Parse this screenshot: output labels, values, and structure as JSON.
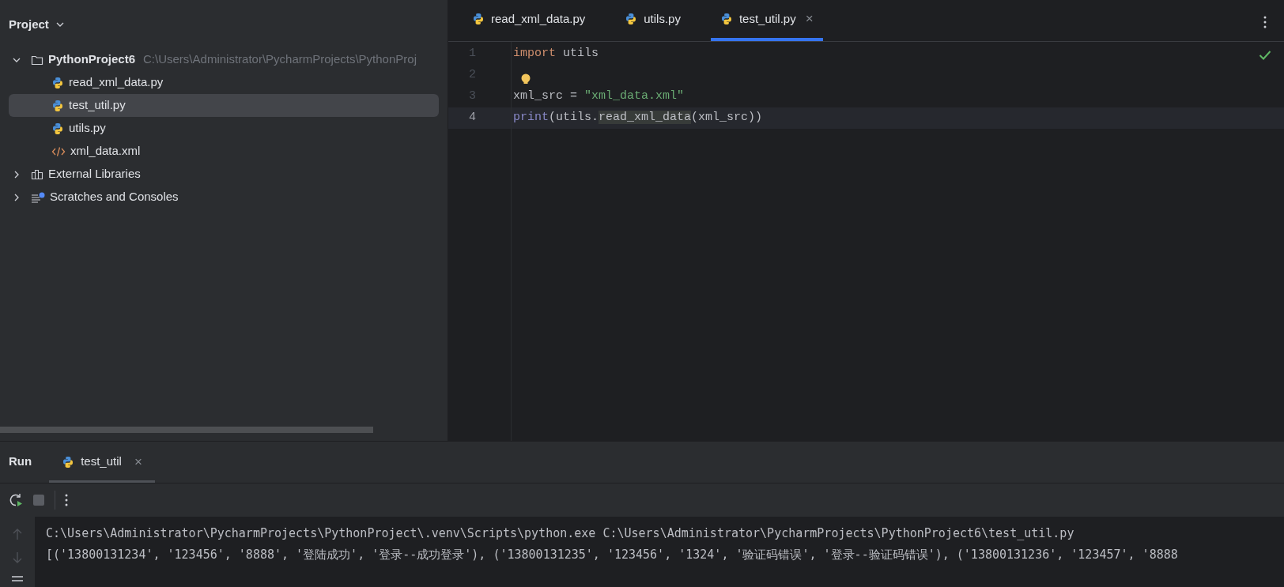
{
  "sidebar": {
    "title": "Project",
    "tree": [
      {
        "label": "PythonProject6",
        "path": "C:\\Users\\Administrator\\PycharmProjects\\PythonProj",
        "kind": "folder",
        "expanded": true,
        "selected": false,
        "children": [
          {
            "label": "read_xml_data.py",
            "kind": "python",
            "selected": false
          },
          {
            "label": "test_util.py",
            "kind": "python",
            "selected": true
          },
          {
            "label": "utils.py",
            "kind": "python",
            "selected": false
          },
          {
            "label": "xml_data.xml",
            "kind": "xml",
            "selected": false
          }
        ]
      },
      {
        "label": "External Libraries",
        "kind": "library",
        "expanded": false,
        "selected": false
      },
      {
        "label": "Scratches and Consoles",
        "kind": "scratches",
        "expanded": false,
        "selected": false
      }
    ]
  },
  "editor": {
    "tabs": [
      {
        "label": "read_xml_data.py",
        "selected": false
      },
      {
        "label": "utils.py",
        "selected": false
      },
      {
        "label": "test_util.py",
        "selected": true,
        "close": "×"
      }
    ],
    "lines": [
      {
        "number": "1",
        "current": false,
        "tokens": [
          {
            "text": "import ",
            "kind": "keyword"
          },
          {
            "text": "utils",
            "kind": "plain"
          }
        ]
      },
      {
        "number": "2",
        "current": false
      },
      {
        "number": "3",
        "current": false,
        "tokens": [
          {
            "text": "xml_src = ",
            "kind": "plain"
          },
          {
            "text": "\"xml_data.xml\"",
            "kind": "string"
          }
        ]
      },
      {
        "number": "4",
        "current": true,
        "tokens": [
          {
            "text": "print",
            "kind": "builtin"
          },
          {
            "text": "(utils.",
            "kind": "plain"
          },
          {
            "text": "read_xml_data",
            "kind": "usage"
          },
          {
            "text": "(xml_src))",
            "kind": "plain"
          }
        ]
      }
    ]
  },
  "run": {
    "title": "Run",
    "tabs": [
      {
        "label": "test_util",
        "selected": true,
        "close": "×"
      }
    ],
    "output": [
      "C:\\Users\\Administrator\\PycharmProjects\\PythonProject\\.venv\\Scripts\\python.exe C:\\Users\\Administrator\\PycharmProjects\\PythonProject6\\test_util.py",
      "[('13800131234', '123456', '8888', '登陆成功', '登录--成功登录'), ('13800131235', '123456', '1324', '验证码错误', '登录--验证码错误'), ('13800131236', '123457', '8888"
    ]
  }
}
